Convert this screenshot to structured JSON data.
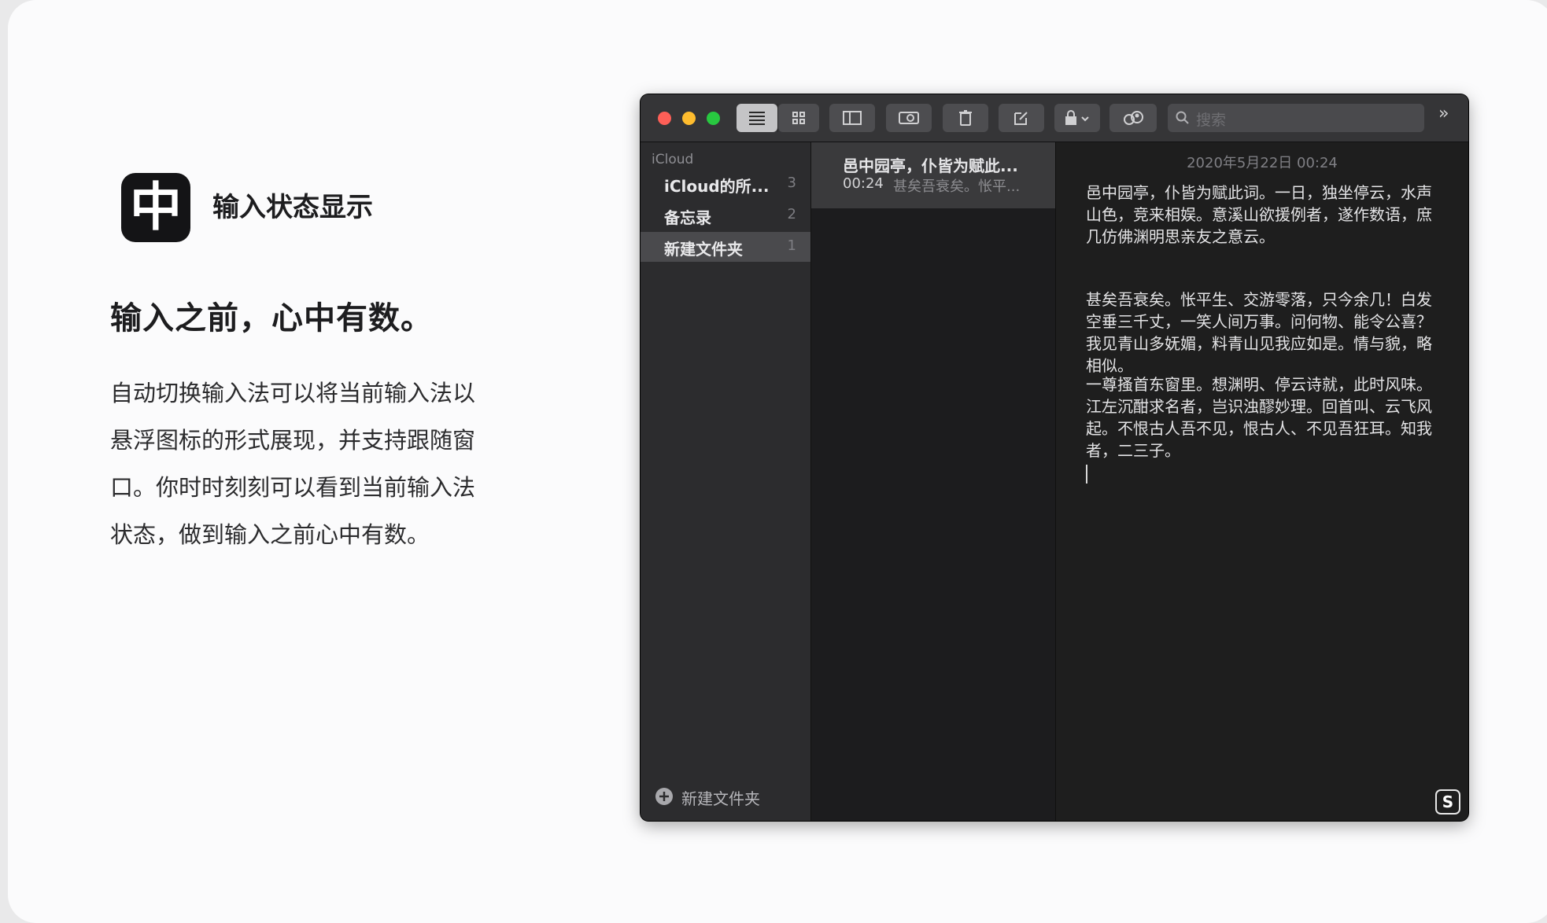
{
  "promo": {
    "feature_icon_glyph": "中",
    "feature_title": "输入状态显示",
    "headline": "输入之前，心中有数。",
    "description_lines": [
      "自动切换输入法可以将当前输入法以",
      "悬浮图标的形式展现，并支持跟随窗",
      "口。你时时刻刻可以看到当前输入法",
      "状态，做到输入之前心中有数。"
    ]
  },
  "window": {
    "toolbar": {
      "icons": [
        "list-view-icon",
        "gallery-view-icon",
        "sidebar-toggle-icon",
        "attachments-icon",
        "trash-icon",
        "compose-icon",
        "lock-icon",
        "share-icon"
      ],
      "search_placeholder": "搜索"
    },
    "sidebar": {
      "section_label": "iCloud",
      "folders": [
        {
          "name": "iCloud的所...",
          "count": "3"
        },
        {
          "name": "备忘录",
          "count": "2"
        },
        {
          "name": "新建文件夹",
          "count": "1",
          "selected": true
        }
      ],
      "new_folder_label": "新建文件夹"
    },
    "note_list": [
      {
        "title": "邑中园亭，仆皆为赋此...",
        "time": "00:24",
        "snippet": "甚矣吾衰矣。怅平..."
      }
    ],
    "editor": {
      "date": "2020年5月22日 00:24",
      "paragraphs": [
        "邑中园亭，仆皆为赋此词。一日，独坐停云，水声山色，竞来相娱。意溪山欲援例者，遂作数语，庶几仿佛渊明思亲友之意云。",
        "甚矣吾衰矣。怅平生、交游零落，只今余几！白发空垂三千丈，一笑人间万事。问何物、能令公喜？我见青山多妩媚，料青山见我应如是。情与貌，略相似。",
        "一尊搔首东窗里。想渊明、停云诗就，此时风味。江左沉酣求名者，岂识浊醪妙理。回首叫、云飞风起。不恨古人吾不见，恨古人、不见吾狂耳。知我者，二三子。"
      ],
      "ime_indicator": "S"
    }
  }
}
